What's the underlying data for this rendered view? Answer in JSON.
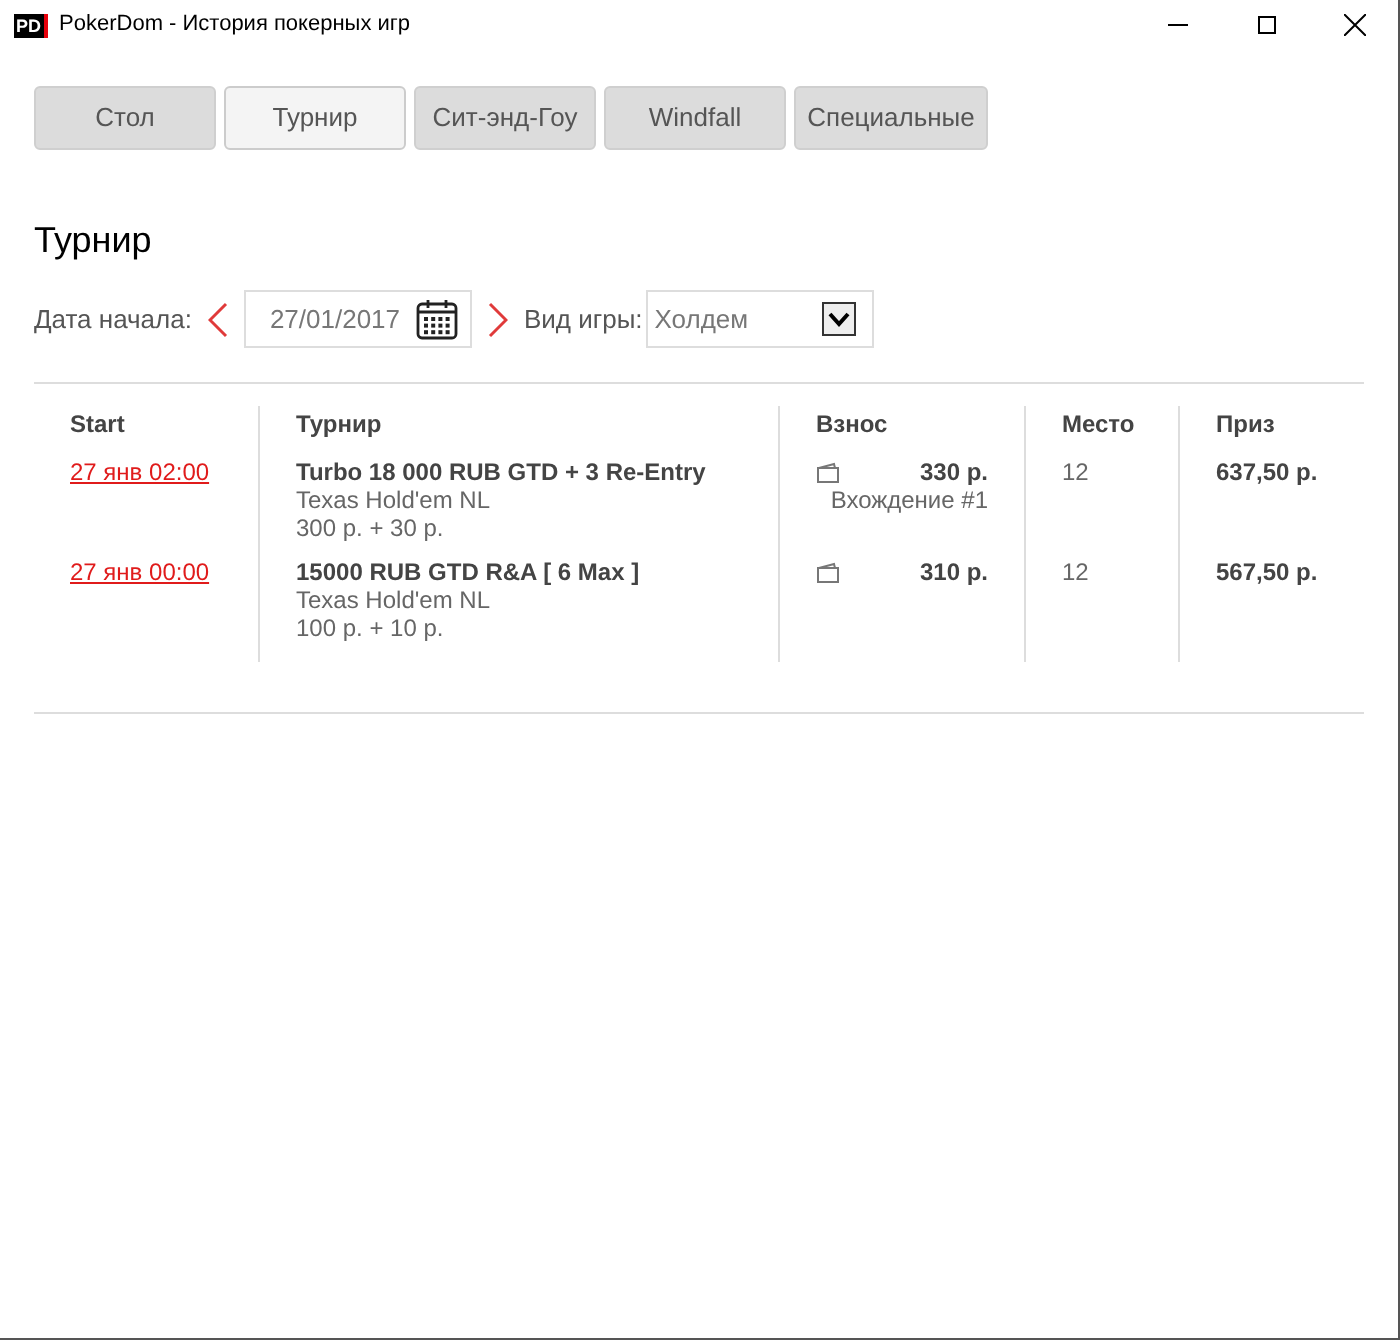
{
  "window": {
    "logo": "PD",
    "title": "PokerDom - История покерных игр"
  },
  "tabs": [
    {
      "label": "Стол",
      "selected": false
    },
    {
      "label": "Турнир",
      "selected": true
    },
    {
      "label": "Сит-энд-Гоу",
      "selected": false
    },
    {
      "label": "Windfall",
      "selected": false
    },
    {
      "label": "Специальные",
      "selected": false
    }
  ],
  "heading": "Турнир",
  "filters": {
    "date_label": "Дата начала:",
    "date_value": "27/01/2017",
    "game_label": "Вид игры:",
    "game_value": "Холдем"
  },
  "table": {
    "columns": [
      "Start",
      "Турнир",
      "Взнос",
      "Место",
      "Приз"
    ],
    "rows": [
      {
        "start": "27 янв 02:00",
        "name": "Turbo 18 000 RUB GTD + 3 Re-Entry",
        "game": "Texas Hold'em NL",
        "buyin_detail": "300 р. + 30 р.",
        "fee": "330 р.",
        "entry": "Вхождение #1",
        "place": "12",
        "prize": "637,50 р."
      },
      {
        "start": "27 янв 00:00",
        "name": "15000 RUB GTD R&A [ 6 Max ]",
        "game": "Texas Hold'em NL",
        "buyin_detail": "100 р. + 10 р.",
        "fee": "310 р.",
        "place": "12",
        "prize": "567,50 р."
      }
    ]
  }
}
